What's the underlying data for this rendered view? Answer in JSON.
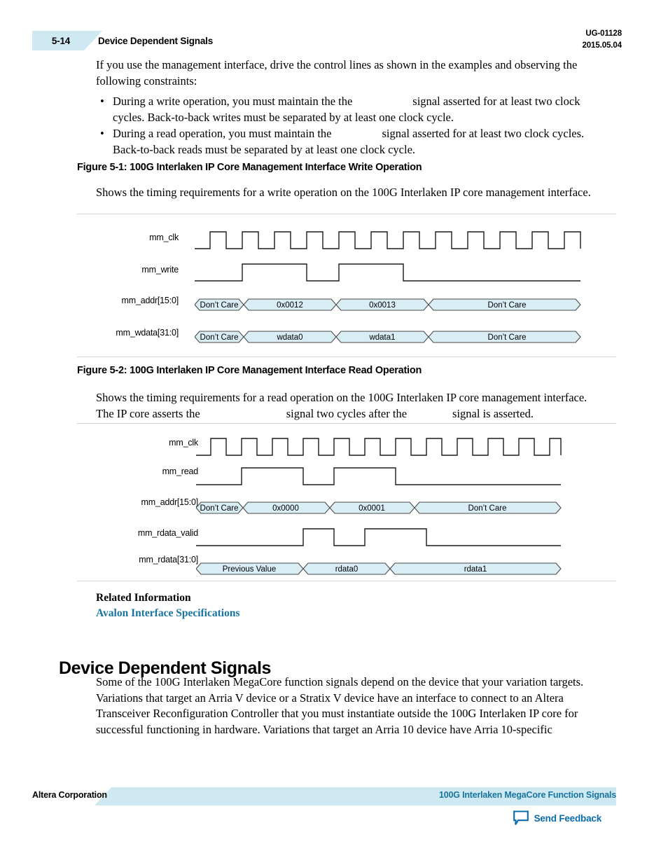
{
  "header": {
    "page_number": "5-14",
    "section_title": "Device Dependent Signals",
    "doc_id": "UG-01128",
    "doc_date": "2015.05.04"
  },
  "intro_paragraph": "If you use the management interface, drive the control lines as shown in the examples and observing the following constraints:",
  "bullets": [
    {
      "marker": "•",
      "text_before": "During a write operation, you must maintain the the",
      "text_after": "signal asserted for at least two clock cycles. Back-to-back writes must be separated by at least one clock cycle."
    },
    {
      "marker": "•",
      "text_before": "During a read operation, you must maintain the",
      "text_after": "signal asserted for at least two clock cycles. Back-to-back reads must be separated by at least one clock cycle."
    }
  ],
  "figures": [
    {
      "caption": "Figure 5-1: 100G Interlaken IP Core Management Interface Write Operation",
      "description": "Shows the timing requirements for a write operation on the 100G Interlaken IP core management interface.",
      "signals": [
        {
          "label": "mm_clk",
          "type": "clock"
        },
        {
          "label": "mm_write",
          "type": "logic"
        },
        {
          "label": "mm_addr[15:0]",
          "type": "bus",
          "segments": [
            "Don’t Care",
            "0x0012",
            "0x0013",
            "Don’t Care"
          ]
        },
        {
          "label": "mm_wdata[31:0]",
          "type": "bus",
          "segments": [
            "Don’t Care",
            "wdata0",
            "wdata1",
            "Don’t Care"
          ]
        }
      ]
    },
    {
      "caption": "Figure 5-2: 100G Interlaken IP Core Management Interface Read Operation",
      "description_part1": "Shows the timing requirements for a read operation on the 100G Interlaken IP core management interface. The IP core asserts the",
      "description_part2": "signal two cycles after the",
      "description_part3": "signal is asserted.",
      "signals": [
        {
          "label": "mm_clk",
          "type": "clock"
        },
        {
          "label": "mm_read",
          "type": "logic"
        },
        {
          "label": "mm_addr[15:0]",
          "type": "bus",
          "segments": [
            "Don’t Care",
            "0x0000",
            "0x0001",
            "Don’t Care"
          ]
        },
        {
          "label": "mm_rdata_valid",
          "type": "logic"
        },
        {
          "label": "mm_rdata[31:0]",
          "type": "bus",
          "segments": [
            "Previous Value",
            "rdata0",
            "rdata1"
          ]
        }
      ]
    }
  ],
  "related_information": {
    "heading": "Related Information",
    "link_label": "Avalon Interface Specifications"
  },
  "section": {
    "heading": "Device Dependent Signals",
    "body": "Some of the 100G Interlaken MegaCore function signals depend on the device that your variation targets. Variations that target an Arria V device or a Stratix V device have an interface to connect to an Altera Transceiver Reconfiguration Controller that you must instantiate outside the 100G Interlaken IP core for successful functioning in hardware. Variations that target an Arria 10 device have Arria 10-specific"
  },
  "footer": {
    "left_label": "Altera Corporation",
    "right_label": "100G Interlaken MegaCore Function Signals",
    "feedback_label": "Send Feedback"
  },
  "colors": {
    "accent_light_blue": "#cfe9f2",
    "link_blue": "#1874a0",
    "bus_fill": "#d9edf5",
    "rule_gray": "#d4d4d4"
  }
}
